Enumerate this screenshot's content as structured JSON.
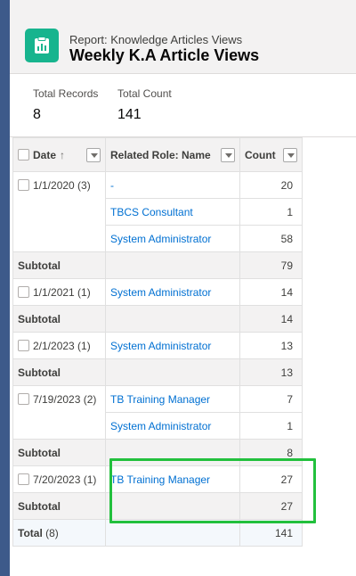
{
  "header": {
    "subtitle": "Report: Knowledge Articles Views",
    "title": "Weekly K.A Article Views",
    "icon": "report-icon"
  },
  "stats": [
    {
      "label": "Total Records",
      "value": "8"
    },
    {
      "label": "Total Count",
      "value": "141"
    }
  ],
  "table": {
    "columns": {
      "date": "Date",
      "role": "Related Role: Name",
      "count": "Count"
    },
    "groups": [
      {
        "date": "1/1/2020 (3)",
        "rows": [
          {
            "role": "-",
            "count": "20"
          },
          {
            "role": "TBCS Consultant",
            "count": "1"
          },
          {
            "role": "System Administrator",
            "count": "58"
          }
        ],
        "subtotal": "79"
      },
      {
        "date": "1/1/2021 (1)",
        "rows": [
          {
            "role": "System Administrator",
            "count": "14"
          }
        ],
        "subtotal": "14"
      },
      {
        "date": "2/1/2023 (1)",
        "rows": [
          {
            "role": "System Administrator",
            "count": "13"
          }
        ],
        "subtotal": "13"
      },
      {
        "date": "7/19/2023 (2)",
        "rows": [
          {
            "role": "TB Training Manager",
            "count": "7"
          },
          {
            "role": "System Administrator",
            "count": "1"
          }
        ],
        "subtotal": "8"
      },
      {
        "date": "7/20/2023 (1)",
        "rows": [
          {
            "role": "TB Training Manager",
            "count": "27"
          }
        ],
        "subtotal": "27"
      }
    ],
    "subtotal_label": "Subtotal",
    "total_label": "Total",
    "total_count_note": "(8)",
    "total_value": "141"
  },
  "colors": {
    "highlight": "#22c03d",
    "link": "#0070d2",
    "icon_bg": "#17b48e"
  }
}
